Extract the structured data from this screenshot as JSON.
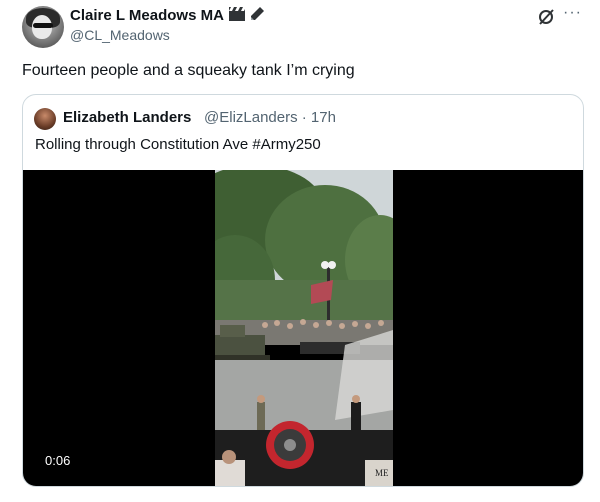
{
  "post": {
    "author": {
      "display_name": "Claire L Meadows MA",
      "handle": "@CL_Meadows",
      "badge_icons": [
        "clapperboard-icon",
        "pencil-icon"
      ]
    },
    "text": "Fourteen people and a squeaky tank I’m crying",
    "actions": {
      "grok_icon": "grok-icon",
      "more_label": "···"
    }
  },
  "quoted_post": {
    "author": {
      "display_name": "Elizabeth Landers",
      "handle_time": "@ElizLanders · 17h"
    },
    "text": "Rolling through Constitution Ave #Army250",
    "video": {
      "duration": "0:06",
      "frame_sign_text": "ME"
    }
  }
}
